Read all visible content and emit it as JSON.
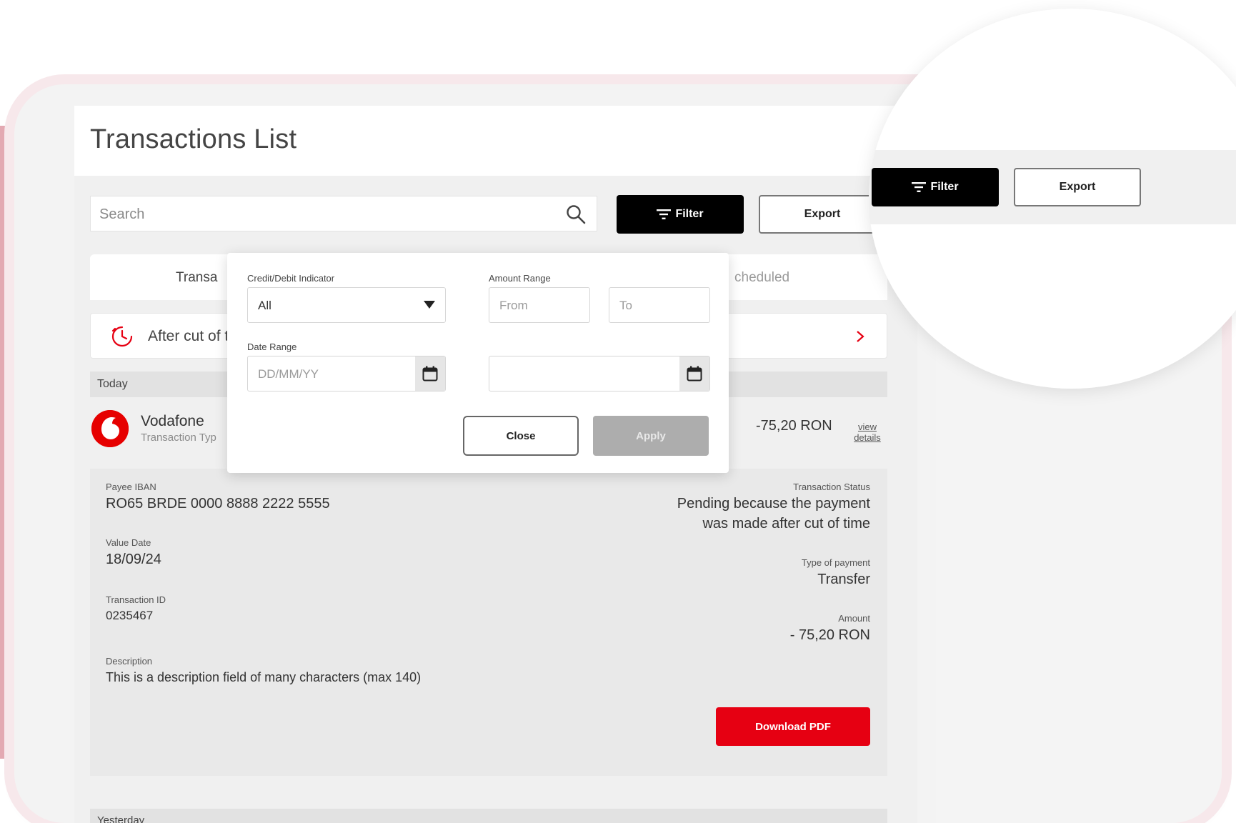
{
  "page": {
    "title": "Transactions List",
    "search": {
      "placeholder": "Search"
    },
    "toolbar": {
      "filter_label": "Filter",
      "export_label": "Export"
    },
    "tabs": [
      {
        "label": "Transa"
      },
      {
        "label": "cheduled"
      }
    ],
    "notice": {
      "text": "After cut of t"
    },
    "groups": {
      "today": "Today",
      "yesterday": "Yesterday"
    },
    "transaction": {
      "name": "Vodafone",
      "type": "Transaction Typ",
      "amount": "-75,20 RON",
      "view_details": "view details"
    },
    "details": {
      "payee_iban_label": "Payee IBAN",
      "payee_iban": "RO65 BRDE 0000 8888 2222 5555",
      "value_date_label": "Value Date",
      "value_date": "18/09/24",
      "transaction_id_label": "Transaction ID",
      "transaction_id": "0235467",
      "description_label": "Description",
      "description": "This is a description field of many characters (max 140)",
      "status_label": "Transaction Status",
      "status_line1": "Pending because the payment",
      "status_line2": "was made after cut of time",
      "payment_type_label": "Type of payment",
      "payment_type": "Transfer",
      "amount_label": "Amount",
      "amount": "- 75,20 RON",
      "download_label": "Download PDF"
    },
    "filter_popup": {
      "credit_debit_label": "Credit/Debit Indicator",
      "credit_debit_value": "All",
      "amount_range_label": "Amount Range",
      "from_placeholder": "From",
      "to_placeholder": "To",
      "date_range_label": "Date Range",
      "date_placeholder": "DD/MM/YY",
      "close_label": "Close",
      "apply_label": "Apply"
    },
    "magnifier": {
      "filter_label": "Filter",
      "export_label": "Export"
    }
  },
  "colors": {
    "brand_red": "#e60012",
    "primary_black": "#000000",
    "disabled_gray": "#adadad",
    "accent_pink": "#e3a9b2"
  },
  "icons": [
    "search-icon",
    "filter-icon",
    "clock-icon",
    "chevron-right-icon",
    "vodafone-logo",
    "caret-down-icon",
    "calendar-icon"
  ]
}
